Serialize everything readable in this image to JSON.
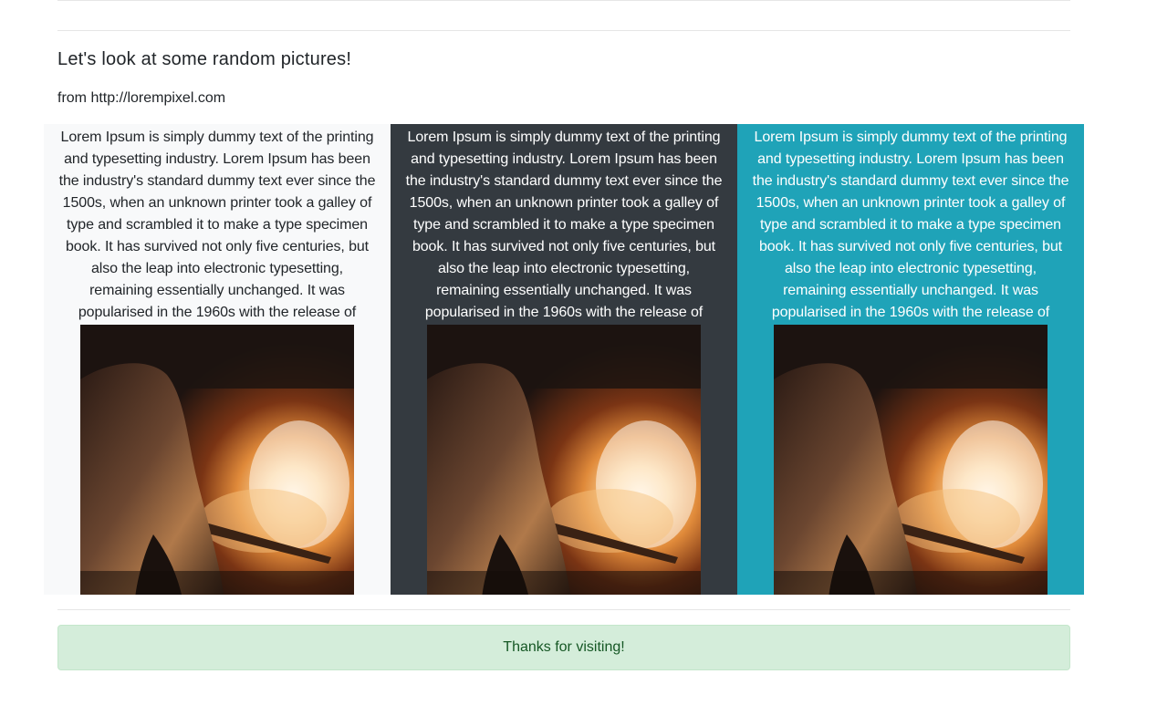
{
  "heading": "Let's look at some random pictures!",
  "source_line": "from http://lorempixel.com",
  "cards": [
    {
      "text": "Lorem Ipsum is simply dummy text of the printing and typesetting industry. Lorem Ipsum has been the industry's standard dummy text ever since the 1500s, when an unknown printer took a galley of type and scrambled it to make a type specimen book. It has survived not only five centuries, but also the leap into electronic typesetting, remaining essentially unchanged. It was popularised in the 1960s with the release of",
      "background": "#f8f9fa"
    },
    {
      "text": "Lorem Ipsum is simply dummy text of the printing and typesetting industry. Lorem Ipsum has been the industry's standard dummy text ever since the 1500s, when an unknown printer took a galley of type and scrambled it to make a type specimen book. It has survived not only five centuries, but also the leap into electronic typesetting, remaining essentially unchanged. It was popularised in the 1960s with the release of",
      "background": "#343a40"
    },
    {
      "text": "Lorem Ipsum is simply dummy text of the printing and typesetting industry. Lorem Ipsum has been the industry's standard dummy text ever since the 1500s, when an unknown printer took a galley of type and scrambled it to make a type specimen book. It has survived not only five centuries, but also the leap into electronic typesetting, remaining essentially unchanged. It was popularised in the 1960s with the release of",
      "background": "#1fa3b8"
    }
  ],
  "alert_text": "Thanks for visiting!",
  "colors": {
    "alert_bg": "#d4edda",
    "alert_text": "#155724"
  }
}
